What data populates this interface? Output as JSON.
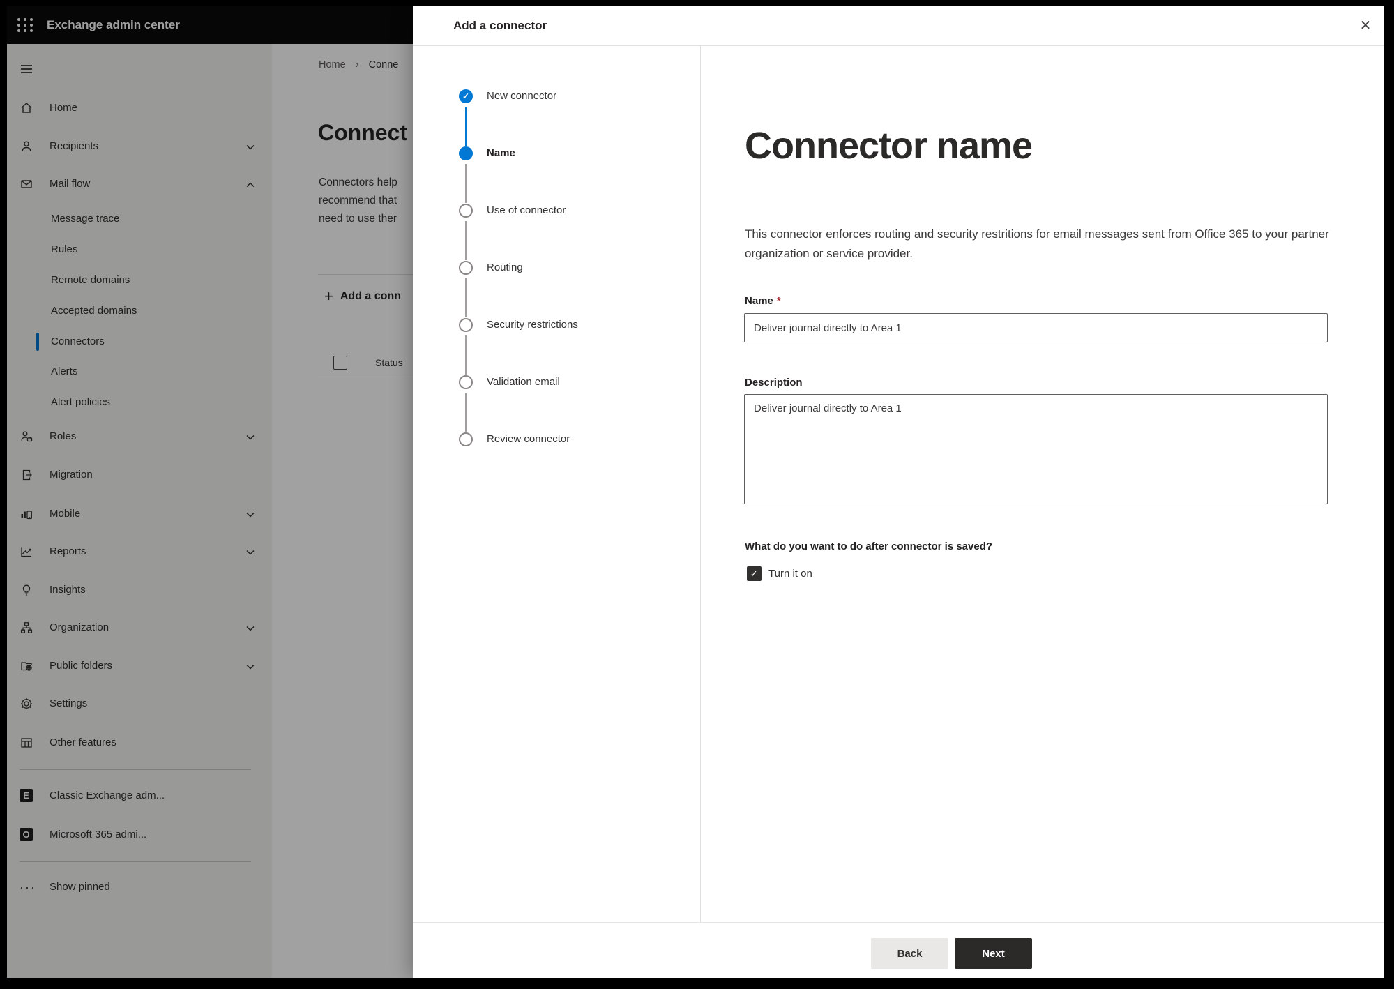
{
  "app": {
    "title": "Exchange admin center"
  },
  "sidebar": {
    "items": {
      "home": "Home",
      "recipients": "Recipients",
      "mailflow": "Mail flow",
      "message_trace": "Message trace",
      "rules": "Rules",
      "remote_domains": "Remote domains",
      "accepted_domains": "Accepted domains",
      "connectors": "Connectors",
      "alerts": "Alerts",
      "alert_policies": "Alert policies",
      "roles": "Roles",
      "migration": "Migration",
      "mobile": "Mobile",
      "reports": "Reports",
      "insights": "Insights",
      "organization": "Organization",
      "public_folders": "Public folders",
      "settings": "Settings",
      "other_features": "Other features",
      "classic_exchange": "Classic Exchange adm...",
      "m365_admin": "Microsoft 365 admi...",
      "show_pinned": "Show pinned"
    },
    "selected": "Connectors"
  },
  "page": {
    "breadcrumb": {
      "home": "Home",
      "separator": "›",
      "current": "Conne"
    },
    "heading": "Connect",
    "intro": {
      "line1": "Connectors help",
      "line2": "recommend that",
      "line3": "need to use ther"
    },
    "add_button": {
      "plus": "+",
      "label": "Add a conn"
    },
    "table": {
      "status_header": "Status"
    }
  },
  "modal": {
    "title": "Add a connector",
    "close": "✕",
    "steps": [
      {
        "label": "New connector",
        "state": "completed",
        "glyph": "✓"
      },
      {
        "label": "Name",
        "state": "current"
      },
      {
        "label": "Use of connector",
        "state": "upcoming"
      },
      {
        "label": "Routing",
        "state": "upcoming"
      },
      {
        "label": "Security restrictions",
        "state": "upcoming"
      },
      {
        "label": "Validation email",
        "state": "upcoming"
      },
      {
        "label": "Review connector",
        "state": "upcoming"
      }
    ],
    "content": {
      "heading": "Connector name",
      "description": "This connector enforces routing and security restritions for email messages sent from Office 365 to your partner organization or service provider.",
      "name_label": "Name",
      "required_mark": "*",
      "name_value": "Deliver journal directly to Area 1",
      "description_label": "Description",
      "description_value": "Deliver journal directly to Area 1",
      "question": "What do you want to do after connector is saved?",
      "turn_on_label": "Turn it on",
      "turn_on_checked": true,
      "turn_on_glyph": "✓"
    },
    "footer": {
      "back": "Back",
      "next": "Next"
    }
  },
  "colors": {
    "accent_blue": "#0078d4",
    "topbar_bg": "#0b0b0b",
    "sidebar_bg": "#f3f2f1",
    "required_red": "#a4262c",
    "next_button_bg": "#2b2a29",
    "back_button_bg": "#e9e8e7"
  }
}
